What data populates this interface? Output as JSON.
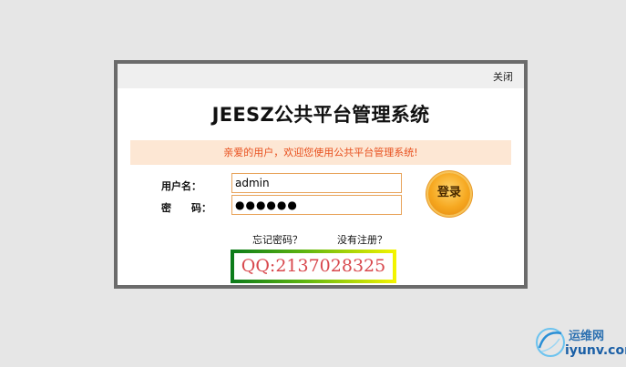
{
  "dialog": {
    "close_label": "关闭",
    "title": "JEESZ公共平台管理系统",
    "welcome": "亲爱的用户，欢迎您使用公共平台管理系统!"
  },
  "form": {
    "username_label": "用户名：",
    "password_label": "密　　码：",
    "username_value": "admin",
    "password_value": "●●●●●●",
    "login_label": "登录"
  },
  "links": {
    "forgot": "忘记密码？",
    "register": "没有注册？"
  },
  "banner": {
    "qq": "QQ:2137028325"
  },
  "watermark": {
    "cn": "运维网",
    "en": "iyunv.com"
  },
  "colors": {
    "background": "#e6e6e6",
    "dialog_border": "#6b6b6b",
    "welcome_bg": "#fde7d4",
    "welcome_text": "#e8501e",
    "input_border": "#e8a35a",
    "login_button": "#f6a820",
    "qq_text": "#d8484d"
  }
}
